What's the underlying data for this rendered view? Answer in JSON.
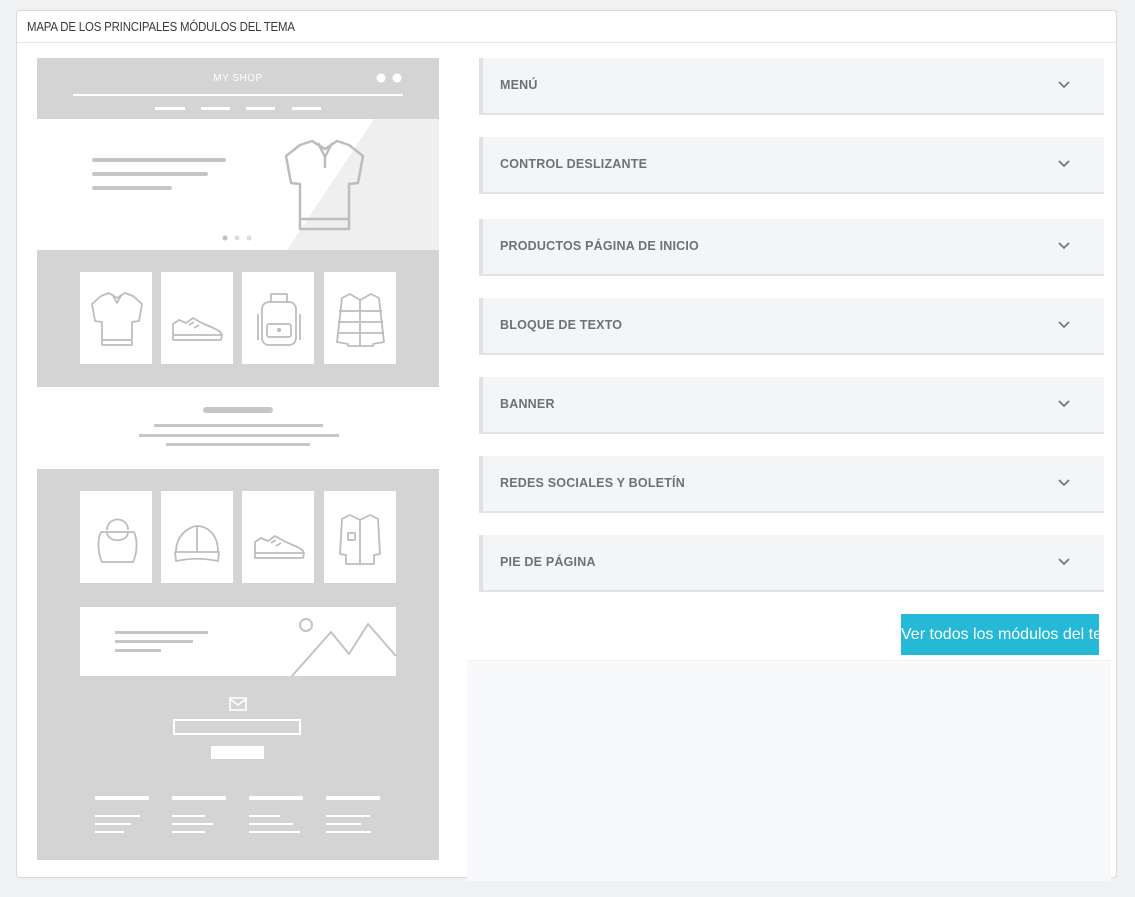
{
  "panel": {
    "title": "MAPA DE LOS PRINCIPALES MÓDULOS DEL TEMA"
  },
  "mockup": {
    "shop_name": "MY SHOP"
  },
  "accordion": {
    "items": [
      {
        "label": "MENÚ"
      },
      {
        "label": "CONTROL DESLIZANTE"
      },
      {
        "label": "PRODUCTOS PÁGINA DE INICIO"
      },
      {
        "label": "BLOQUE DE TEXTO"
      },
      {
        "label": "BANNER"
      },
      {
        "label": "REDES SOCIALES Y BOLETÍN"
      },
      {
        "label": "PIE DE PÁGINA"
      }
    ]
  },
  "view_all_button": {
    "label": "Ver todos los módulos del tema"
  },
  "colors": {
    "accent": "#25b9d7",
    "mockup_gray": "#d4d4d4",
    "item_bg": "#f4f5f6"
  },
  "icons": [
    "polo-shirt-icon",
    "sneaker-icon",
    "backpack-icon",
    "jacket-icon",
    "handbag-icon",
    "cap-icon",
    "shirt-icon",
    "mail-icon",
    "mountain-image-icon",
    "chevron-down-icon"
  ]
}
